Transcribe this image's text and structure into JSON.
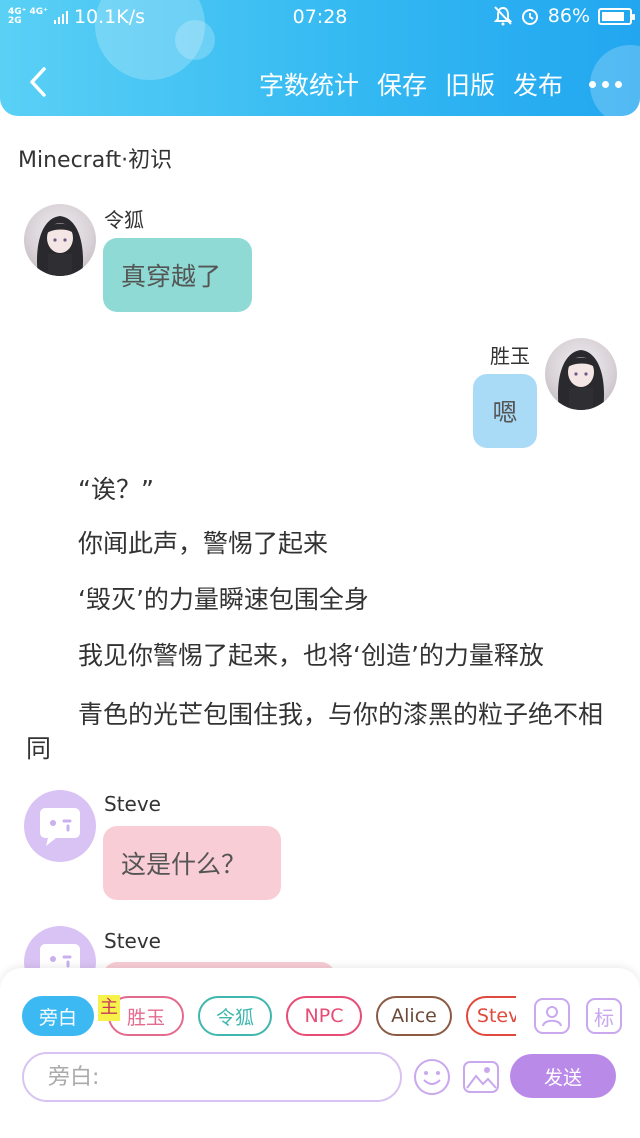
{
  "status_bar": {
    "network_top": "4G⁺ 4G⁺",
    "network_bottom": "2G",
    "speed": "10.1K/s",
    "time": "07:28",
    "battery": "86%",
    "battery_level": 0.86
  },
  "toolbar": {
    "back_icon": "chevron-left-icon",
    "word_count": "字数统计",
    "save": "保存",
    "old_version": "旧版",
    "publish": "发布",
    "more_icon": "more-dots-icon"
  },
  "document": {
    "title": "Minecraft·初识"
  },
  "messages": {
    "m1": {
      "name": "令狐",
      "text": "真穿越了"
    },
    "m2": {
      "name": "胜玉",
      "text": "嗯"
    },
    "narration": [
      "“诶？”",
      "你闻此声，警惕了起来",
      "‘毁灭’的力量瞬速包围全身",
      "我见你警惕了起来，也将‘创造’的力量释放",
      "青色的光芒包围住我，与你的漆黑的粒子绝不相同"
    ],
    "m3": {
      "name": "Steve",
      "text": "这是什么？"
    },
    "m4": {
      "name": "Steve",
      "text": ""
    }
  },
  "composer": {
    "host_tag": "主",
    "roles": [
      "旁白",
      "胜玉",
      "令狐",
      "NPC",
      "Alice",
      "Steve"
    ],
    "input_placeholder": "旁白:",
    "send": "发送",
    "icons": [
      "contact-icon",
      "tag-icon",
      "emoji-icon",
      "image-icon"
    ],
    "side_tag": "标"
  },
  "colors": {
    "header_gradient_start": "#5ad0f5",
    "header_gradient_end": "#22a6f0",
    "bubble_teal": "#8fdad4",
    "bubble_blue": "#a9dbf7",
    "bubble_pink": "#f9cdd6",
    "role_active": "#3cb9f3",
    "send_button": "#b98ae8"
  }
}
